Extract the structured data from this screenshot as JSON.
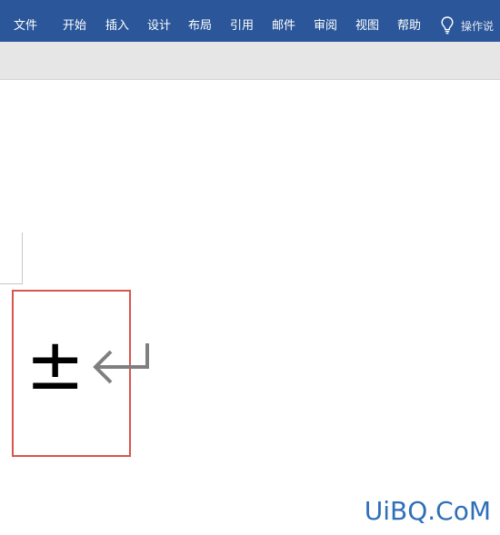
{
  "ribbon": {
    "tabs": [
      "文件",
      "开始",
      "插入",
      "设计",
      "布局",
      "引用",
      "邮件",
      "审阅",
      "视图",
      "帮助"
    ],
    "tell_me": {
      "icon": "lightbulb-icon",
      "text": "操作说"
    },
    "color": "#2b579a"
  },
  "document": {
    "symbol": "±",
    "paragraph_mark": "return-arrow-icon",
    "highlight_color": "#d9534f"
  },
  "watermark": {
    "text": "UiBQ.CoM",
    "color": "#2f6fb8"
  }
}
